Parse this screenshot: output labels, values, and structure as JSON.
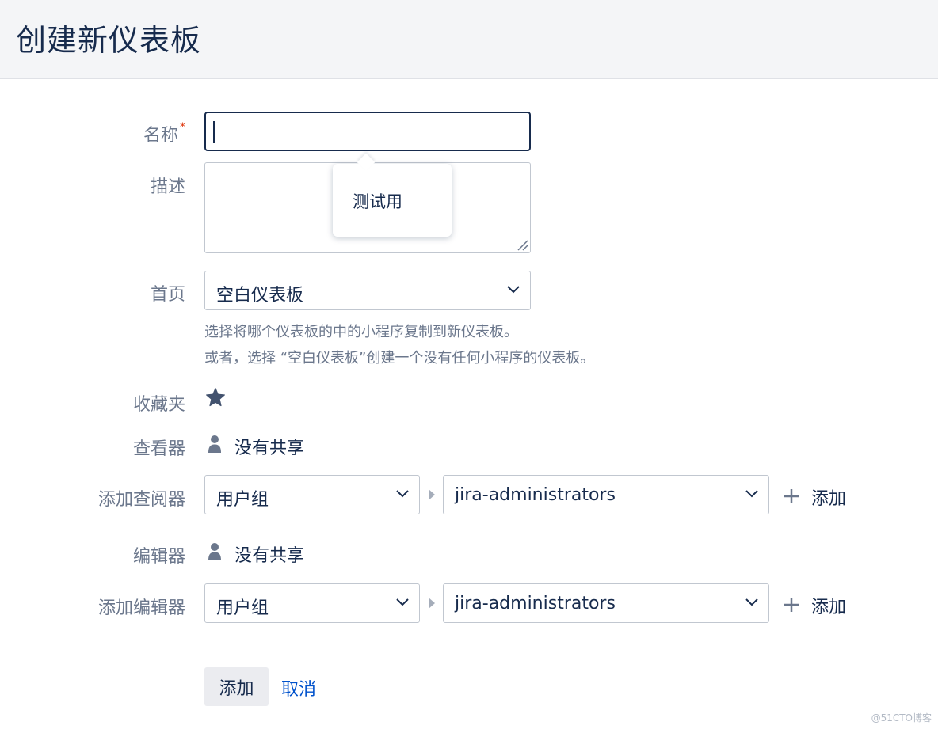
{
  "header": {
    "title": "创建新仪表板"
  },
  "form": {
    "name_label": "名称",
    "required_mark": "*",
    "name_value": "",
    "description_label": "描述",
    "description_tooltip": "测试用",
    "start_from_label": "首页",
    "start_from_value": "空白仪表板",
    "help_line1": "选择将哪个仪表板的中的小程序复制到新仪表板。",
    "help_line2": "或者，选择 “空白仪表板”创建一个没有任何小程序的仪表板。",
    "favourite_label": "收藏夹",
    "viewers_label": "查看器",
    "viewers_value": "没有共享",
    "add_viewers_label": "添加查阅器",
    "add_viewers_type": "用户组",
    "add_viewers_group": "jira-administrators",
    "add_viewers_button": "添加",
    "editors_label": "编辑器",
    "editors_value": "没有共享",
    "add_editors_label": "添加编辑器",
    "add_editors_type": "用户组",
    "add_editors_group": "jira-administrators",
    "add_editors_button": "添加"
  },
  "actions": {
    "submit": "添加",
    "cancel": "取消"
  },
  "watermark": "@51CTO博客",
  "icons": {
    "favourite": "star-icon",
    "user": "user-icon",
    "add": "plus-icon",
    "dropdown": "chevron-down-icon"
  },
  "colors": {
    "accent_link": "#0052cc",
    "required": "#de350b",
    "text": "#172b4d",
    "muted": "#6b778c"
  }
}
